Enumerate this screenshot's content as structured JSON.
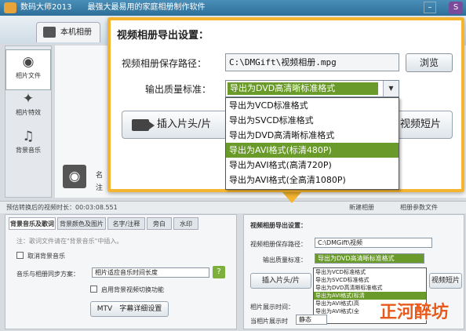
{
  "app": {
    "title": "数码大师2013　　最强大最易用的家庭相册制作软件",
    "corner_logo": "S"
  },
  "top_tabs": [
    {
      "label": "本机相册"
    }
  ],
  "sidebar": {
    "items": [
      {
        "label": "相片文件",
        "icon": "camera-icon",
        "glyph": "◉"
      },
      {
        "label": "相片特效",
        "icon": "effects-icon",
        "glyph": "✦"
      },
      {
        "label": "背景音乐",
        "icon": "music-icon",
        "glyph": "♫"
      }
    ]
  },
  "thumb": {
    "line1": "名",
    "line2": "注"
  },
  "dialog": {
    "title": "视频相册导出设置：",
    "save_path_label": "视频相册保存路径：",
    "save_path_value": "C:\\DMGift\\视频相册.mpg",
    "browse_label": "浏览",
    "quality_label": "输出质量标准：",
    "quality_selected": "导出为DVD高清晰标准格式",
    "insert_button_label": "插入片头/片",
    "video_short_label": "视频短片",
    "options": [
      "导出为VCD标准格式",
      "导出为SVCD标准格式",
      "导出为DVD高清晰标准格式",
      "导出为AVI格式(标清480P)",
      "导出为AVI格式(高清720P)",
      "导出为AVI格式(全高清1080P)"
    ],
    "highlighted_index": 3
  },
  "statusbar": {
    "text": "预估转换后的视频时长：00:03:08.551",
    "new_album": "新建相册",
    "album_params": "相册参数文件"
  },
  "lower_left": {
    "tabs": [
      "背景音乐及歌词",
      "背景颜色及图片",
      "名字/注释",
      "旁白",
      "水印"
    ],
    "hint": "注：歌词文件请在\"背景音乐\"中插入。",
    "cancel_music": "取消背景音乐",
    "sync_label": "音乐与相册同步方案：",
    "sync_value": "相片适应音乐时间长度",
    "enable_switch": "启用背景视频切换功能",
    "mtv_button": "MTV　字幕详细设置"
  },
  "lower_right": {
    "title": "视频相册导出设置：",
    "save_path_label": "视频相册保存路径：",
    "save_path_value": "C:\\DMGift\\视频",
    "quality_label": "输出质量标准：",
    "quality_selected": "导出为DVD高清晰标准格式",
    "insert_label": "插入片头/片",
    "video_label": "视频短片",
    "photo_time_label": "相片展示时间：",
    "album_show_label": "当相片展示时",
    "album_show_value": "静态",
    "mini_options": [
      "导出为VCD标准格式",
      "导出为SVCD标准格式",
      "导出为DVD高清晰标准格式",
      "导出为AVI格式(标清",
      "导出为AVI格式(高",
      "导出为AVI格式(全"
    ]
  },
  "watermark": "正河醉坊",
  "colors": {
    "accent": "#f5b530",
    "highlight": "#6a9a2a"
  }
}
